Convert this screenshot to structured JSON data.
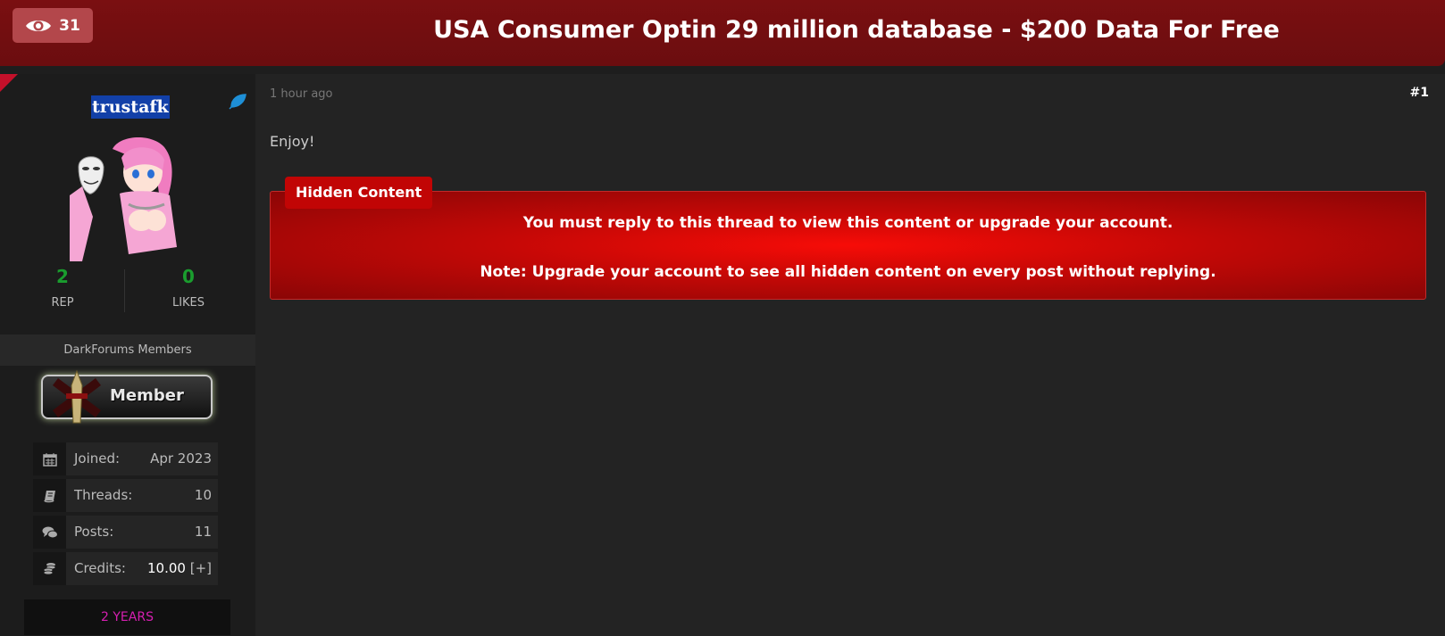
{
  "header": {
    "views_count": "31",
    "thread_title": "USA Consumer Optin 29 million database - $200 Data For Free"
  },
  "author": {
    "username": "trustafk",
    "rep_value": "2",
    "rep_label": "REP",
    "likes_value": "0",
    "likes_label": "LIKES",
    "group": "DarkForums Members",
    "badge": "Member",
    "info": [
      {
        "icon": "calendar-icon",
        "label": "Joined:",
        "value": "Apr 2023"
      },
      {
        "icon": "book-icon",
        "label": "Threads:",
        "value": "10"
      },
      {
        "icon": "comments-icon",
        "label": "Posts:",
        "value": "11"
      },
      {
        "icon": "coins-icon",
        "label": "Credits:",
        "value": "10.00",
        "extra": "[+]"
      }
    ],
    "years": "2 YEARS"
  },
  "post": {
    "time": "1 hour ago",
    "number": "#1",
    "body": "Enjoy!",
    "hidden_label": "Hidden Content",
    "hidden_line1": "You must reply to this thread to view this content or upgrade your account.",
    "hidden_line2": "Note: Upgrade your account to see all hidden content on every post without replying."
  },
  "colors": {
    "header_bg": "#7a0f11",
    "views_badge": "#b3474b",
    "stat_green": "#1a9d2e",
    "years_magenta": "#d61fb1",
    "hidden_red": "#f70c07"
  }
}
